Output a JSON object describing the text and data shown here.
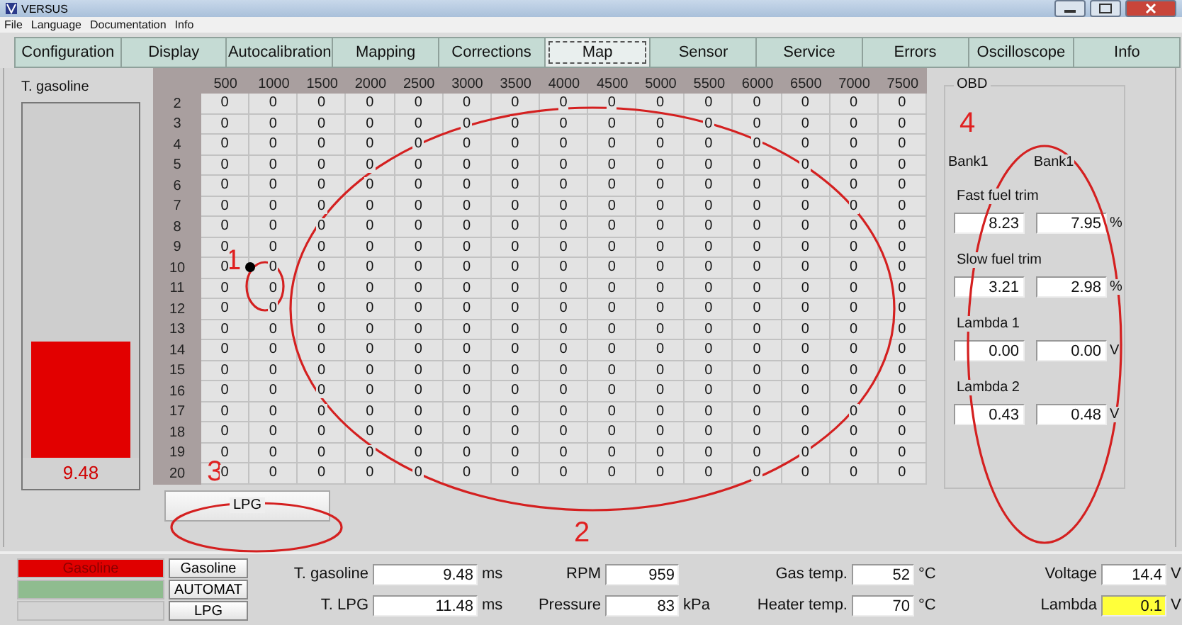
{
  "window": {
    "title": "VERSUS"
  },
  "menu": [
    "File",
    "Language",
    "Documentation",
    "Info"
  ],
  "tabs": [
    {
      "label": "Configuration",
      "selected": false
    },
    {
      "label": "Display",
      "selected": false
    },
    {
      "label": "Autocalibration",
      "selected": false
    },
    {
      "label": "Mapping",
      "selected": false
    },
    {
      "label": "Corrections",
      "selected": false
    },
    {
      "label": "Map",
      "selected": true
    },
    {
      "label": "Sensor",
      "selected": false
    },
    {
      "label": "Service",
      "selected": false
    },
    {
      "label": "Errors",
      "selected": false
    },
    {
      "label": "Oscilloscope",
      "selected": false
    },
    {
      "label": "Info",
      "selected": false
    }
  ],
  "gauge": {
    "label": "T. gasoline",
    "level": 0.33,
    "value": "9.48"
  },
  "map_table": {
    "columns": [
      "500",
      "1000",
      "1500",
      "2000",
      "2500",
      "3000",
      "3500",
      "4000",
      "4500",
      "5000",
      "5500",
      "6000",
      "6500",
      "7000",
      "7500"
    ],
    "rows": [
      {
        "label": "2",
        "cursor": false,
        "cells": [
          "0",
          "0",
          "0",
          "0",
          "0",
          "0",
          "0",
          "0",
          "0",
          "0",
          "0",
          "0",
          "0",
          "0",
          "0"
        ]
      },
      {
        "label": "3",
        "cursor": false,
        "cells": [
          "0",
          "0",
          "0",
          "0",
          "0",
          "0",
          "0",
          "0",
          "0",
          "0",
          "0",
          "0",
          "0",
          "0",
          "0"
        ]
      },
      {
        "label": "4",
        "cursor": false,
        "cells": [
          "0",
          "0",
          "0",
          "0",
          "0",
          "0",
          "0",
          "0",
          "0",
          "0",
          "0",
          "0",
          "0",
          "0",
          "0"
        ]
      },
      {
        "label": "5",
        "cursor": false,
        "cells": [
          "0",
          "0",
          "0",
          "0",
          "0",
          "0",
          "0",
          "0",
          "0",
          "0",
          "0",
          "0",
          "0",
          "0",
          "0"
        ]
      },
      {
        "label": "6",
        "cursor": false,
        "cells": [
          "0",
          "0",
          "0",
          "0",
          "0",
          "0",
          "0",
          "0",
          "0",
          "0",
          "0",
          "0",
          "0",
          "0",
          "0"
        ]
      },
      {
        "label": "7",
        "cursor": false,
        "cells": [
          "0",
          "0",
          "0",
          "0",
          "0",
          "0",
          "0",
          "0",
          "0",
          "0",
          "0",
          "0",
          "0",
          "0",
          "0"
        ]
      },
      {
        "label": "8",
        "cursor": false,
        "cells": [
          "0",
          "0",
          "0",
          "0",
          "0",
          "0",
          "0",
          "0",
          "0",
          "0",
          "0",
          "0",
          "0",
          "0",
          "0"
        ]
      },
      {
        "label": "9",
        "cursor": false,
        "cells": [
          "0",
          "0",
          "0",
          "0",
          "0",
          "0",
          "0",
          "0",
          "0",
          "0",
          "0",
          "0",
          "0",
          "0",
          "0"
        ]
      },
      {
        "label": "10",
        "cursor": true,
        "cells": [
          "0",
          "0",
          "0",
          "0",
          "0",
          "0",
          "0",
          "0",
          "0",
          "0",
          "0",
          "0",
          "0",
          "0",
          "0"
        ]
      },
      {
        "label": "11",
        "cursor": false,
        "cells": [
          "0",
          "0",
          "0",
          "0",
          "0",
          "0",
          "0",
          "0",
          "0",
          "0",
          "0",
          "0",
          "0",
          "0",
          "0"
        ]
      },
      {
        "label": "12",
        "cursor": false,
        "cells": [
          "0",
          "0",
          "0",
          "0",
          "0",
          "0",
          "0",
          "0",
          "0",
          "0",
          "0",
          "0",
          "0",
          "0",
          "0"
        ]
      },
      {
        "label": "13",
        "cursor": false,
        "cells": [
          "0",
          "0",
          "0",
          "0",
          "0",
          "0",
          "0",
          "0",
          "0",
          "0",
          "0",
          "0",
          "0",
          "0",
          "0"
        ]
      },
      {
        "label": "14",
        "cursor": false,
        "cells": [
          "0",
          "0",
          "0",
          "0",
          "0",
          "0",
          "0",
          "0",
          "0",
          "0",
          "0",
          "0",
          "0",
          "0",
          "0"
        ]
      },
      {
        "label": "15",
        "cursor": false,
        "cells": [
          "0",
          "0",
          "0",
          "0",
          "0",
          "0",
          "0",
          "0",
          "0",
          "0",
          "0",
          "0",
          "0",
          "0",
          "0"
        ]
      },
      {
        "label": "16",
        "cursor": false,
        "cells": [
          "0",
          "0",
          "0",
          "0",
          "0",
          "0",
          "0",
          "0",
          "0",
          "0",
          "0",
          "0",
          "0",
          "0",
          "0"
        ]
      },
      {
        "label": "17",
        "cursor": false,
        "cells": [
          "0",
          "0",
          "0",
          "0",
          "0",
          "0",
          "0",
          "0",
          "0",
          "0",
          "0",
          "0",
          "0",
          "0",
          "0"
        ]
      },
      {
        "label": "18",
        "cursor": false,
        "cells": [
          "0",
          "0",
          "0",
          "0",
          "0",
          "0",
          "0",
          "0",
          "0",
          "0",
          "0",
          "0",
          "0",
          "0",
          "0"
        ]
      },
      {
        "label": "19",
        "cursor": false,
        "cells": [
          "0",
          "0",
          "0",
          "0",
          "0",
          "0",
          "0",
          "0",
          "0",
          "0",
          "0",
          "0",
          "0",
          "0",
          "0"
        ]
      },
      {
        "label": "20",
        "cursor": false,
        "cells": [
          "0",
          "0",
          "0",
          "0",
          "0",
          "0",
          "0",
          "0",
          "0",
          "0",
          "0",
          "0",
          "0",
          "0",
          "0"
        ]
      }
    ]
  },
  "fuel_button": "LPG",
  "obd": {
    "title": "OBD",
    "banks": [
      "Bank1",
      "Bank1"
    ],
    "groups": [
      {
        "label": "Fast fuel trim",
        "values": [
          "8.23",
          "7.95"
        ],
        "unit": "%"
      },
      {
        "label": "Slow fuel trim",
        "values": [
          "3.21",
          "2.98"
        ],
        "unit": "%"
      },
      {
        "label": "Lambda 1",
        "values": [
          "0.00",
          "0.00"
        ],
        "unit": "V"
      },
      {
        "label": "Lambda 2",
        "values": [
          "0.43",
          "0.48"
        ],
        "unit": "V"
      }
    ]
  },
  "status": {
    "modes": [
      {
        "color": "#e00000",
        "label": "Gasoline",
        "button": "Gasoline"
      },
      {
        "color": "#8fbc8f",
        "button": "AUTOMAT"
      },
      {
        "color": "#d4d4d4",
        "button": "LPG"
      }
    ],
    "readings": [
      {
        "label": "T. gasoline",
        "value": "9.48",
        "unit": "ms",
        "highlighted": false
      },
      {
        "label": "RPM",
        "value": "959",
        "highlighted": false
      },
      {
        "label": "Gas temp.",
        "value": "52",
        "unit": "°C",
        "highlighted": false
      },
      {
        "label": "Voltage",
        "value": "14.4",
        "unit": "V",
        "highlighted": false
      },
      {
        "label": "T. LPG",
        "value": "11.48",
        "unit": "ms",
        "highlighted": false
      },
      {
        "label": "Pressure",
        "value": "83",
        "unit": "kPa",
        "highlighted": false
      },
      {
        "label": "Heater temp.",
        "value": "70",
        "unit": "°C",
        "highlighted": false
      },
      {
        "label": "Lambda",
        "value": "0.1",
        "unit": "V",
        "highlighted": true
      }
    ]
  },
  "annotations": [
    "1",
    "2",
    "3",
    "4"
  ]
}
